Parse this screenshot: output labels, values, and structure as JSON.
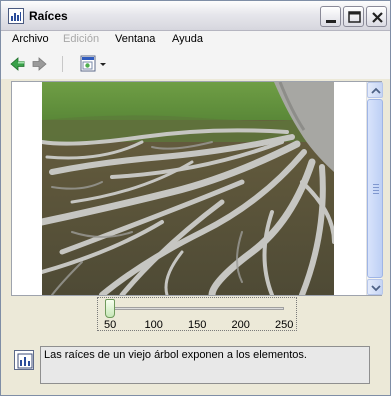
{
  "window": {
    "title": "Raíces"
  },
  "menu": {
    "items": [
      {
        "label": "Archivo",
        "enabled": true
      },
      {
        "label": "Edición",
        "enabled": false
      },
      {
        "label": "Ventana",
        "enabled": true
      },
      {
        "label": "Ayuda",
        "enabled": true
      }
    ]
  },
  "toolbar": {
    "buttons": [
      {
        "icon": "back-arrow-icon",
        "enabled": true
      },
      {
        "icon": "forward-arrow-icon",
        "enabled": false
      },
      {
        "icon": "view-options-icon",
        "enabled": true
      }
    ]
  },
  "zoom": {
    "ticks": [
      "50",
      "100",
      "150",
      "200",
      "250"
    ],
    "min": 50,
    "max": 250,
    "value": 50
  },
  "caption": {
    "text": "Las raíces de un viejo árbol exponen a los elementos."
  },
  "colors": {
    "back_arrow": "#3aa14a",
    "forward_arrow": "#9a9a9a",
    "slider_thumb": "#c7e7b7",
    "scrollbar": "#c6d5f4"
  }
}
